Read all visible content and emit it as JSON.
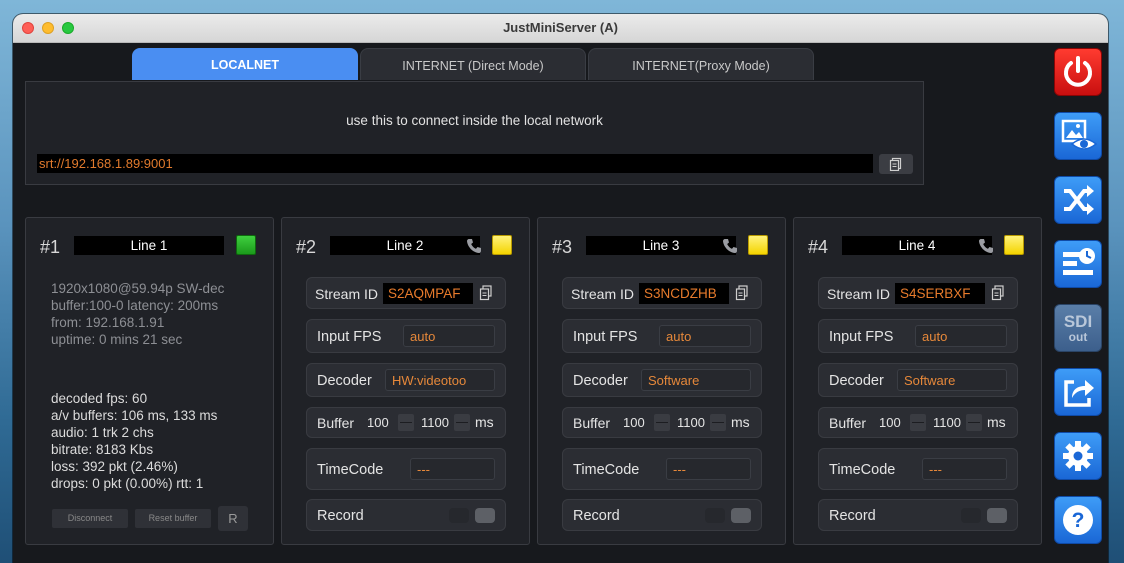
{
  "window": {
    "title": "JustMiniServer (A)"
  },
  "tabs": [
    {
      "label": "LOCALNET",
      "active": true
    },
    {
      "label": "INTERNET (Direct Mode)",
      "active": false
    },
    {
      "label": "INTERNET(Proxy Mode)",
      "active": false
    }
  ],
  "connection": {
    "description": "use this to connect inside the local network",
    "url": "srt://192.168.1.89:9001"
  },
  "panel1": {
    "number": "#1",
    "name": "Line 1",
    "status_color": "#2db52d",
    "info": [
      "1920x1080@59.94p SW-dec",
      "buffer:100-0 latency: 200ms",
      "from: 192.168.1.91",
      "uptime: 0 mins 21 sec"
    ],
    "stats": [
      "decoded fps: 60",
      "a/v buffers: 106 ms, 133 ms",
      "audio: 1 trk 2 chs",
      "bitrate: 8183 Kbs",
      "loss: 392 pkt (2.46%)",
      "drops: 0 pkt (0.00%) rtt: 1"
    ],
    "disconnect_label": "Disconnect",
    "reset_label": "Reset buffer",
    "r_label": "R"
  },
  "labels": {
    "stream_id": "Stream ID",
    "input_fps": "Input FPS",
    "decoder": "Decoder",
    "buffer": "Buffer",
    "ms": "ms",
    "timecode": "TimeCode",
    "record": "Record"
  },
  "panels": [
    {
      "number": "#2",
      "name": "Line 2",
      "status_color": "#f7dc12",
      "stream_id": "S2AQMPAF",
      "input_fps": "auto",
      "decoder": "HW:videotoo",
      "buffer_min": "100",
      "buffer_max": "1100",
      "timecode": "---"
    },
    {
      "number": "#3",
      "name": "Line 3",
      "status_color": "#f7dc12",
      "stream_id": "S3NCDZHB",
      "input_fps": "auto",
      "decoder": "Software",
      "buffer_min": "100",
      "buffer_max": "1100",
      "timecode": "---"
    },
    {
      "number": "#4",
      "name": "Line 4",
      "status_color": "#f7dc12",
      "stream_id": "S4SERBXF",
      "input_fps": "auto",
      "decoder": "Software",
      "buffer_min": "100",
      "buffer_max": "1100",
      "timecode": "---"
    }
  ],
  "sidebar": {
    "sdi_label": "SDI",
    "out_label": "out",
    "icons": [
      "power-icon",
      "image-preview-icon",
      "shuffle-icon",
      "schedule-icon",
      "sdi-out-icon",
      "share-icon",
      "gear-icon",
      "help-icon"
    ]
  },
  "colors": {
    "accent": "#4a8ef2",
    "value": "#e6883a",
    "power": "#e31b1b"
  }
}
